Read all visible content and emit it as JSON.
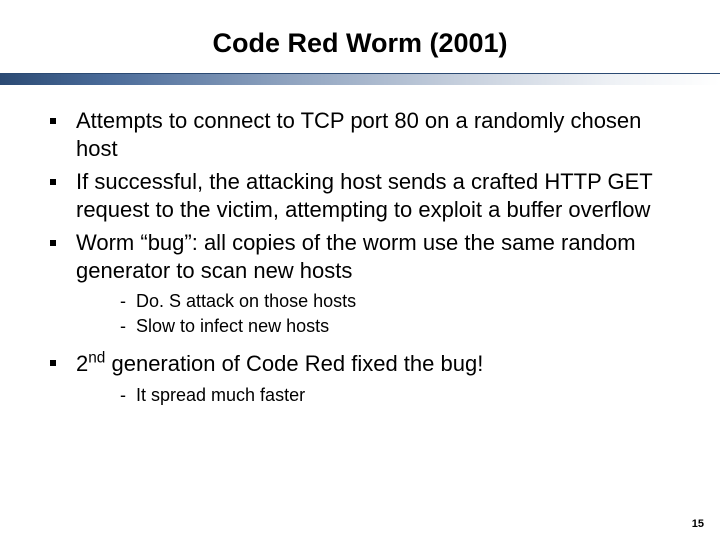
{
  "title": "Code Red Worm (2001)",
  "bullets": [
    {
      "text": "Attempts to connect to TCP port 80 on a randomly chosen host"
    },
    {
      "text": "If successful, the attacking host sends a crafted HTTP GET request to the victim, attempting to exploit a buffer overflow"
    },
    {
      "text": "Worm “bug”: all copies of the worm use the same random generator to scan new hosts",
      "sub": [
        "Do. S attack on those hosts",
        "Slow to infect new hosts"
      ]
    },
    {
      "text_html": "2<span class=\"sup\">nd</span> generation of Code Red fixed the bug!",
      "sub": [
        "It spread much faster"
      ]
    }
  ],
  "page_number": "15"
}
